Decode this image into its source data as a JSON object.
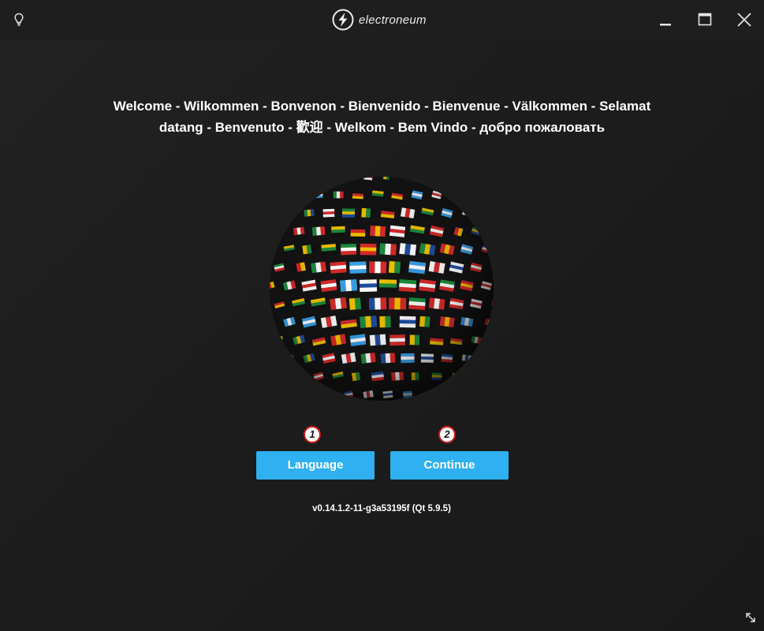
{
  "titlebar": {
    "brand_name": "electroneum",
    "icons": {
      "left": "lightbulb-icon",
      "logo": "electroneum-logo-icon",
      "minimize": "minimize-icon",
      "maximize": "maximize-icon",
      "close": "close-icon"
    }
  },
  "main": {
    "welcome_line1": "Welcome - Wilkommen - Bonvenon - Bienvenido - Bienvenue - Välkommen - Selamat",
    "welcome_line2": "datang - Benvenuto - 歡迎 - Welkom - Bem Vindo - добро пожаловать",
    "globe_image": "flags-globe",
    "markers": [
      "1",
      "2"
    ],
    "language_button": "Language",
    "continue_button": "Continue",
    "version": "v0.14.1.2-11-g3a53195f (Qt 5.9.5)"
  },
  "colors": {
    "background": "#1d1d1d",
    "button": "#2fb0f0",
    "text": "#ffffff",
    "marker_border": "#d01a1a"
  },
  "footer": {
    "resize_icon": "resize-diagonal-icon"
  }
}
